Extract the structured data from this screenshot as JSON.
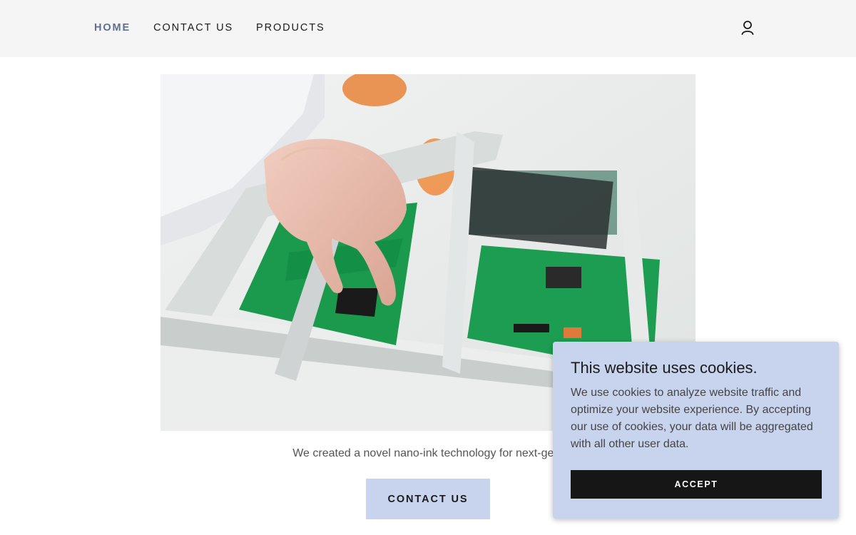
{
  "header": {
    "nav": [
      {
        "label": "HOME",
        "active": true
      },
      {
        "label": "CONTACT US",
        "active": false
      },
      {
        "label": "PRODUCTS",
        "active": false
      }
    ],
    "account_icon": "user-icon"
  },
  "hero": {
    "image_subject": "circuit-board-photo"
  },
  "main": {
    "tagline": "We created a novel nano-ink technology for next-generation bio-ins",
    "cta_label": "CONTACT US"
  },
  "cookie_banner": {
    "title": "This website uses cookies.",
    "body": "We use cookies to analyze website traffic and optimize your website experience. By accepting our use of cookies, your data will be aggregated with all other user data.",
    "accept_label": "ACCEPT"
  },
  "colors": {
    "header_bg": "#f5f5f5",
    "nav_active": "#5d6f92",
    "accent_bg": "#c8d4ee",
    "button_dark": "#161616"
  }
}
